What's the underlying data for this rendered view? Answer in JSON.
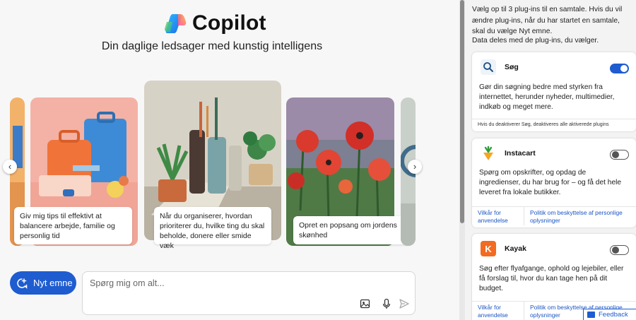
{
  "brand": {
    "name": "Copilot",
    "tagline": "Din daglige ledsager med kunstig intelligens"
  },
  "carousel": {
    "prev_icon": "chevron-left-icon",
    "next_icon": "chevron-right-icon",
    "cards": [
      {
        "caption": "Giv mig tips til effektivt at balancere arbejde, familie og personlig tid"
      },
      {
        "caption": "Når du organiserer, hvordan prioriterer du, hvilke ting du skal beholde, donere eller smide væk"
      },
      {
        "caption": "Opret en popsang om jordens skønhed"
      }
    ]
  },
  "composer": {
    "new_topic_label": "Nyt emne",
    "new_topic_icon": "new-chat-icon",
    "placeholder": "Spørg mig om alt...",
    "tools": [
      "image-upload-icon",
      "microphone-icon",
      "send-icon"
    ]
  },
  "sidebar": {
    "intro": "Vælg op til 3 plug-ins til en samtale. Hvis du vil ændre plug-ins, når du har startet en samtale, skal du vælge Nyt emne.",
    "shared_note": "Data deles med de plug-ins, du vælger.",
    "plugins": [
      {
        "name": "Søg",
        "icon": "search-icon",
        "enabled": true,
        "description": "Gør din søgning bedre med styrken fra internettet, herunder nyheder, multimedier, indkøb og meget mere.",
        "note": "Hvis du deaktiverer Søg, deaktiveres alle aktiverede plugins"
      },
      {
        "name": "Instacart",
        "icon": "carrot-icon",
        "enabled": false,
        "description": "Spørg om opskrifter, og opdag de ingredienser, du har brug for – og få det hele leveret fra lokale butikker.",
        "links": [
          "Vilkår for anvendelse",
          "Politik om beskyttelse af personlige oplysninger"
        ]
      },
      {
        "name": "Kayak",
        "icon": "kayak-logo-icon",
        "icon_letter": "K",
        "enabled": false,
        "description": "Søg efter flyafgange, ophold og lejebiler, eller få forslag til, hvor du kan tage hen på dit budget.",
        "links": [
          "Vilkår for anvendelse",
          "Politik om beskyttelse af personlige oplysninger"
        ]
      }
    ]
  },
  "feedback_label": "Feedback",
  "colors": {
    "accent": "#1e5cd0",
    "toggle_on": "#1e5cd0",
    "kayak": "#f26b21",
    "link": "#1a56c6"
  }
}
